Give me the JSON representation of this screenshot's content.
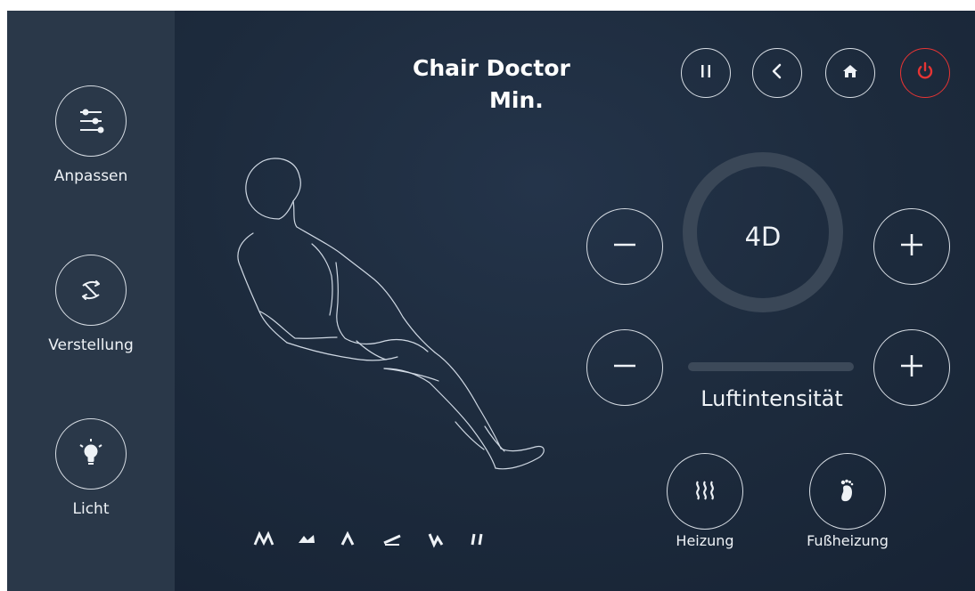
{
  "sidebar": {
    "items": [
      {
        "label": "Anpassen",
        "icon": "sliders-icon"
      },
      {
        "label": "Verstellung",
        "icon": "refresh-icon"
      },
      {
        "label": "Licht",
        "icon": "lightbulb-icon"
      }
    ]
  },
  "header": {
    "title": "Chair Doctor",
    "subtitle": "Min.",
    "buttons": [
      {
        "icon": "pause-icon"
      },
      {
        "icon": "back-icon"
      },
      {
        "icon": "home-icon"
      },
      {
        "icon": "power-icon",
        "color": "#e53434"
      }
    ]
  },
  "controls": {
    "mode_label": "4D",
    "air_label": "Luftintensität",
    "heating_label": "Heizung",
    "foot_heating_label": "Fußheizung"
  },
  "programs": [
    "program-icon-1",
    "program-icon-2",
    "program-icon-3",
    "program-icon-4",
    "program-icon-5",
    "program-icon-6"
  ],
  "colors": {
    "background": "#1d2b3d",
    "sidebar": "#2a3849",
    "accent_power": "#e53434",
    "line": "#d7dde4"
  }
}
